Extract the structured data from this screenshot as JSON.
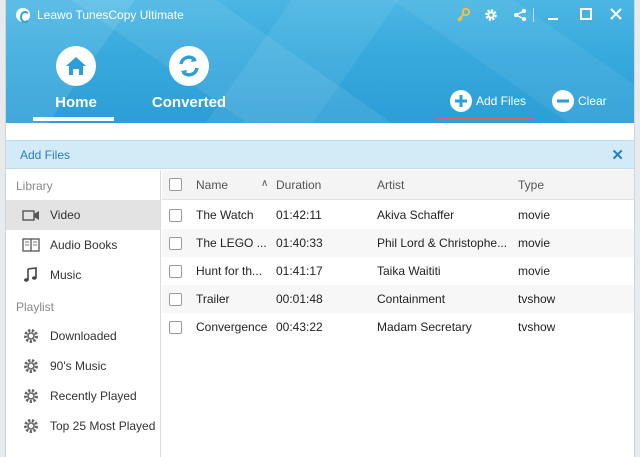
{
  "app": {
    "title": "Leawo TunesCopy Ultimate"
  },
  "nav": {
    "home_label": "Home",
    "converted_label": "Converted",
    "add_files_label": "Add Files",
    "clear_label": "Clear"
  },
  "add_bar": {
    "title": "Add Files",
    "close_glyph": "✕"
  },
  "sidebar": {
    "library_title": "Library",
    "library_items": [
      {
        "label": "Video",
        "icon": "video-icon",
        "active": true
      },
      {
        "label": "Audio Books",
        "icon": "book-icon",
        "active": false
      },
      {
        "label": "Music",
        "icon": "music-note-icon",
        "active": false
      }
    ],
    "playlist_title": "Playlist",
    "playlist_items": [
      {
        "label": "Downloaded",
        "icon": "gear-icon"
      },
      {
        "label": "90's Music",
        "icon": "gear-icon"
      },
      {
        "label": "Recently Played",
        "icon": "gear-icon"
      },
      {
        "label": "Top 25 Most Played",
        "icon": "gear-icon"
      }
    ]
  },
  "table": {
    "columns": {
      "name": "Name",
      "duration": "Duration",
      "artist": "Artist",
      "type": "Type"
    },
    "rows": [
      {
        "name": "The Watch",
        "duration": "01:42:11",
        "artist": "Akiva Schaffer",
        "type": "movie"
      },
      {
        "name": "The LEGO ...",
        "duration": "01:40:33",
        "artist": "Phil Lord & Christophe...",
        "type": "movie"
      },
      {
        "name": "Hunt for th...",
        "duration": "01:41:17",
        "artist": "Taika Waititi",
        "type": "movie"
      },
      {
        "name": "Trailer",
        "duration": "00:01:48",
        "artist": "Containment",
        "type": "tvshow"
      },
      {
        "name": "Convergence",
        "duration": "00:43:22",
        "artist": "Madam Secretary",
        "type": "tvshow"
      }
    ]
  },
  "colors": {
    "header_blue": "#37a9dc",
    "add_bar_bg": "#d3ebf7",
    "accent_text": "#2b7fb6",
    "key_gold": "#f3c040",
    "active_underline_red": "#e35b6c"
  }
}
